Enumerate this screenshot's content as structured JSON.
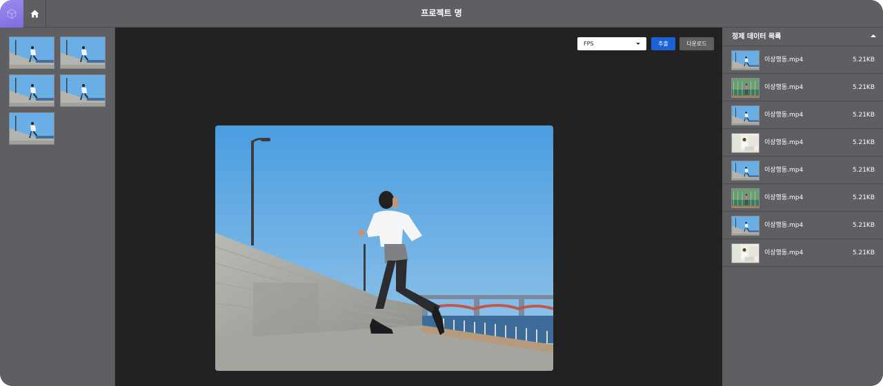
{
  "header": {
    "title": "프로젝트 명",
    "logo_icon": "cube-logo-icon",
    "home_icon": "home-icon"
  },
  "left_panel": {
    "thumbnails": [
      {
        "kind": "runner"
      },
      {
        "kind": "runner"
      },
      {
        "kind": "runner"
      },
      {
        "kind": "runner"
      },
      {
        "kind": "runner"
      }
    ]
  },
  "viewer": {
    "fps_select": {
      "value": "FPS"
    },
    "extract_label": "추출",
    "download_label": "다운로드"
  },
  "right_panel": {
    "title": "정제 데이터 목록",
    "items": [
      {
        "name": "이상행동.mp4",
        "size": "5.21KB",
        "thumb": "runner"
      },
      {
        "name": "이상행동.mp4",
        "size": "5.21KB",
        "thumb": "court"
      },
      {
        "name": "이상행동.mp4",
        "size": "5.21KB",
        "thumb": "runner"
      },
      {
        "name": "이상행동.mp4",
        "size": "5.21KB",
        "thumb": "office"
      },
      {
        "name": "이상행동.mp4",
        "size": "5.21KB",
        "thumb": "runner"
      },
      {
        "name": "이상행동.mp4",
        "size": "5.21KB",
        "thumb": "court"
      },
      {
        "name": "이상행동.mp4",
        "size": "5.21KB",
        "thumb": "runner"
      },
      {
        "name": "이상행동.mp4",
        "size": "5.21KB",
        "thumb": "office"
      }
    ]
  },
  "colors": {
    "panel_bg": "#5e5f63",
    "viewer_bg": "#222222",
    "accent": "#1b62d6",
    "logo": "#8a79e8"
  }
}
